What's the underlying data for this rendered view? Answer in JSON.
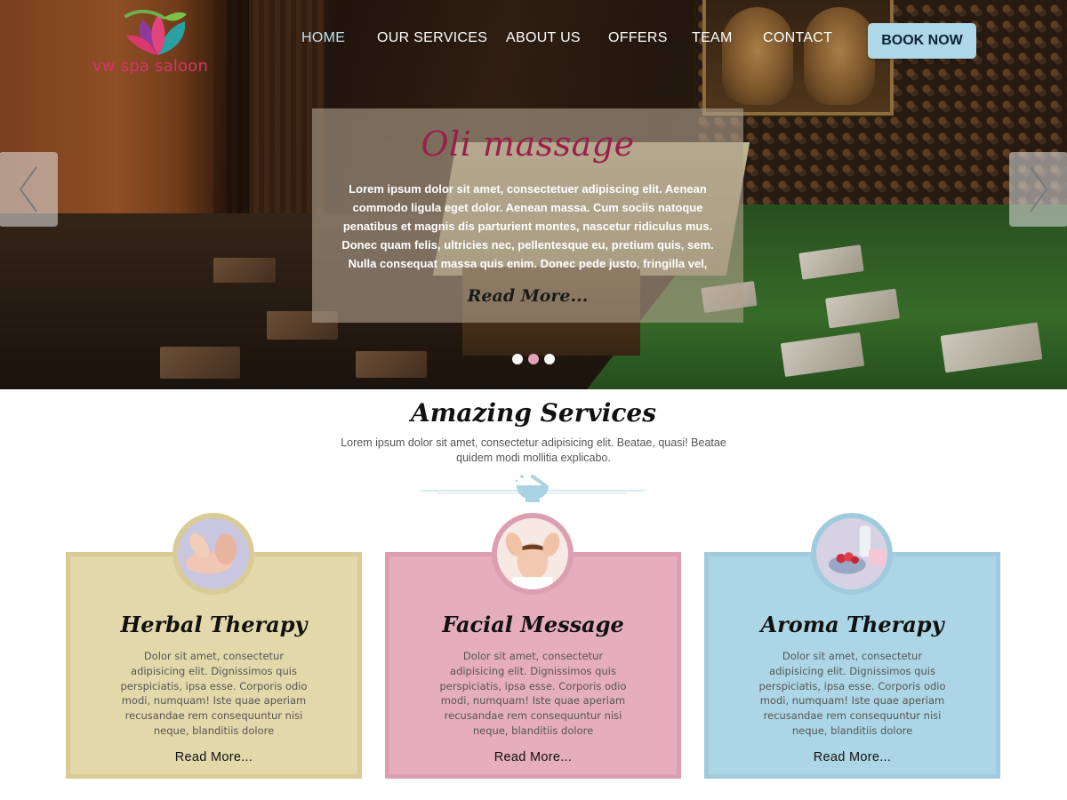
{
  "brand": {
    "name": "vw spa saloon"
  },
  "nav": {
    "items": [
      "HOME",
      "OUR SERVICES",
      "ABOUT US",
      "OFFERS",
      "TEAM",
      "CONTACT"
    ],
    "cta": "BOOK NOW"
  },
  "slider": {
    "title": "Oli  massage",
    "text": "Lorem ipsum dolor sit amet, consectetuer adipiscing elit. Aenean commodo ligula eget dolor. Aenean massa. Cum sociis natoque penatibus et magnis dis parturient montes, nascetur ridiculus mus. Donec quam felis, ultricies nec, pellentesque eu, pretium quis, sem. Nulla consequat massa quis enim. Donec pede justo, fringilla vel,",
    "read_more": "Read More..."
  },
  "services": {
    "title": "Amazing Services",
    "subtitle": "Lorem ipsum dolor sit amet, consectetur adipisicing elit. Beatae, quasi! Beatae quidem modi mollitia explicabo.",
    "cards": [
      {
        "title": "Herbal  Therapy",
        "text": "Dolor sit amet, consectetur adipisicing elit. Dignissimos quis perspiciatis, ipsa esse. Corporis odio modi, numquam! Iste quae aperiam recusandae rem consequuntur nisi neque, blanditiis dolore",
        "more": "Read More...",
        "bg": "#e3d8aa",
        "border": "#d8cb95"
      },
      {
        "title": "Facial Message",
        "text": "Dolor sit amet, consectetur adipisicing elit. Dignissimos quis perspiciatis, ipsa esse. Corporis odio modi, numquam! Iste quae aperiam recusandae rem consequuntur nisi neque, blanditiis dolore",
        "more": "Read More...",
        "bg": "#e5adbe",
        "border": "#dc9fb2"
      },
      {
        "title": "Aroma Therapy",
        "text": "Dolor sit amet, consectetur adipisicing elit. Dignissimos quis perspiciatis, ipsa esse. Corporis odio modi, numquam! Iste quae aperiam recusandae rem consequuntur nisi neque, blanditiis dolore",
        "more": "Read More...",
        "bg": "#acd6e6",
        "border": "#9fcbdd"
      }
    ]
  },
  "colors": {
    "accent_blue": "#aed8e8",
    "brand_pink": "#d6336c",
    "title_maroon": "#9a1f4a"
  }
}
